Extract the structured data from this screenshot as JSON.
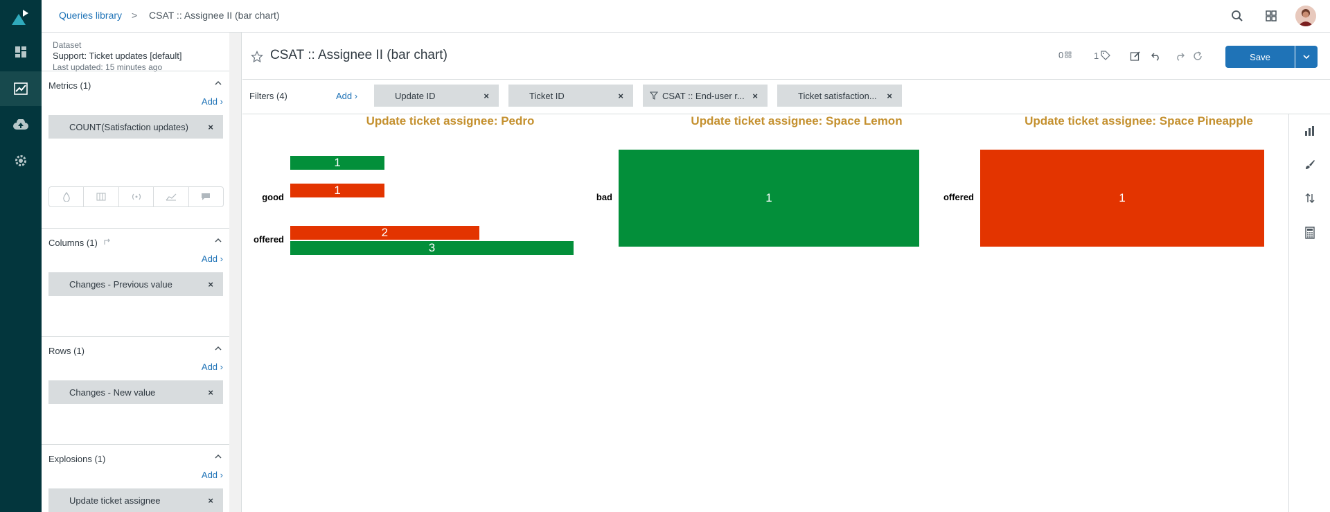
{
  "breadcrumb": {
    "library": "Queries library",
    "separator": ">",
    "current": "CSAT :: Assignee II (bar chart)"
  },
  "dataset": {
    "label": "Dataset",
    "name": "Support: Ticket updates [default]",
    "updated": "Last updated: 15 minutes ago"
  },
  "metrics": {
    "title": "Metrics (1)",
    "add": "Add",
    "items": [
      "COUNT(Satisfaction updates)"
    ]
  },
  "columns": {
    "title": "Columns (1)",
    "add": "Add",
    "items": [
      "Changes - Previous value"
    ]
  },
  "rows": {
    "title": "Rows (1)",
    "add": "Add",
    "items": [
      "Changes - New value"
    ]
  },
  "explosions": {
    "title": "Explosions (1)",
    "add": "Add",
    "items": [
      "Update ticket assignee"
    ]
  },
  "header": {
    "title": "CSAT :: Assignee II (bar chart)",
    "counter_a": "0",
    "counter_b": "1",
    "save": "Save"
  },
  "filters": {
    "title": "Filters (4)",
    "add": "Add",
    "items": [
      "Update ID",
      "Ticket ID",
      "CSAT :: End-user r...",
      "Ticket satisfaction..."
    ]
  },
  "remove_glyph": "×",
  "colors": {
    "green": "#038f3a",
    "red": "#e33400",
    "title": "#c4902e",
    "brand": "#03363d",
    "accent": "#1f73b7"
  },
  "chart_data": [
    {
      "type": "bar",
      "orientation": "horizontal",
      "title": "Update ticket assignee: Pedro",
      "categories": [
        "",
        "good",
        "offered"
      ],
      "bars": [
        {
          "category": "",
          "color": "green",
          "value": 1
        },
        {
          "category": "good",
          "color": "red",
          "value": 1
        },
        {
          "category": "offered",
          "color": "red",
          "value": 2
        },
        {
          "category": "offered",
          "color": "green",
          "value": 3
        }
      ]
    },
    {
      "type": "bar",
      "orientation": "horizontal",
      "title": "Update ticket assignee: Space Lemon",
      "categories": [
        "bad"
      ],
      "bars": [
        {
          "category": "bad",
          "color": "green",
          "value": 1
        }
      ]
    },
    {
      "type": "bar",
      "orientation": "horizontal",
      "title": "Update ticket assignee: Space Pineapple",
      "categories": [
        "offered"
      ],
      "bars": [
        {
          "category": "offered",
          "color": "red",
          "value": 1
        }
      ]
    }
  ]
}
